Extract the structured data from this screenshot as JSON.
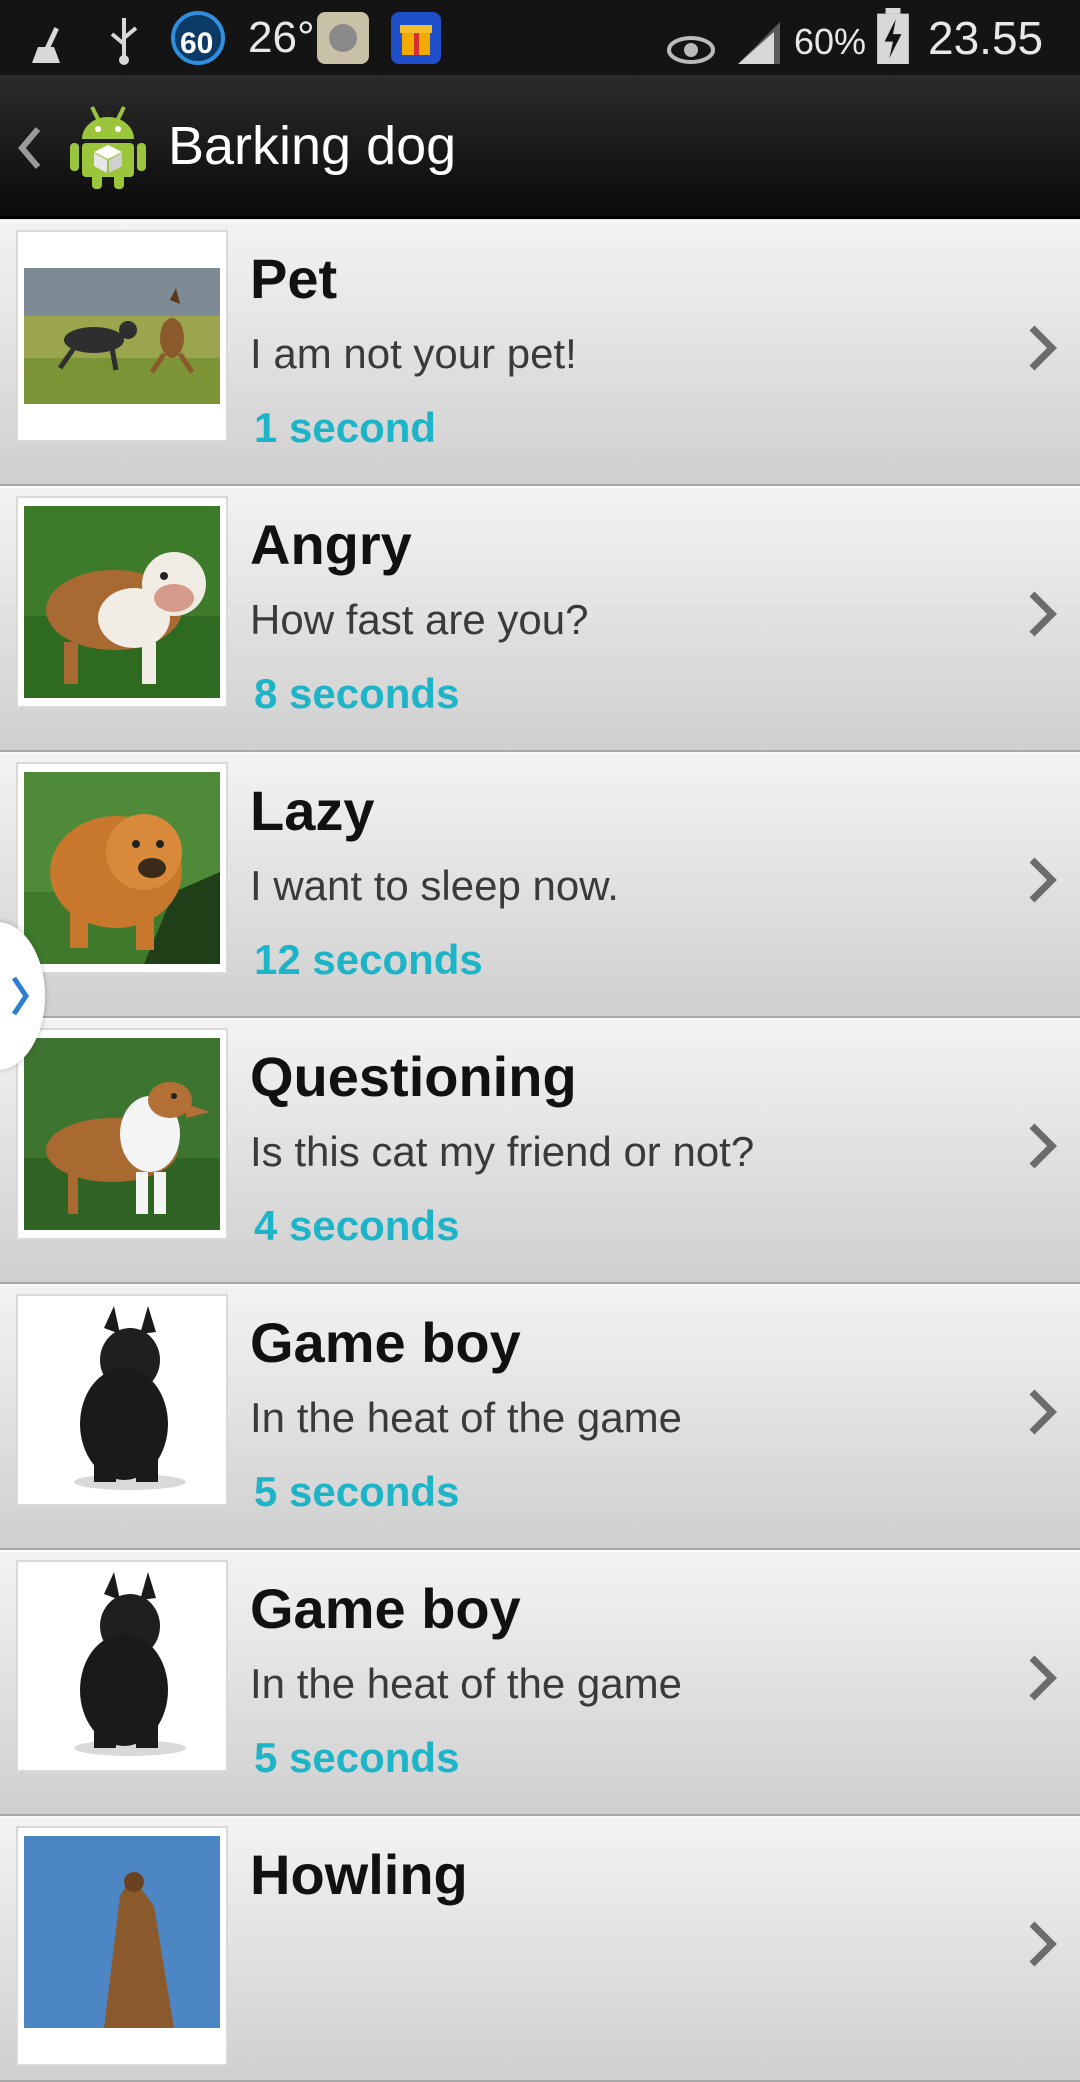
{
  "status_bar": {
    "icons": [
      "broom-icon",
      "usb-icon",
      "speed-60-icon",
      "app-icon",
      "gift-icon",
      "eye-icon",
      "signal-icon",
      "battery-charging-icon"
    ],
    "speed_label": "60",
    "temperature": "26°",
    "battery_percent": "60%",
    "time": "23.55"
  },
  "action_bar": {
    "title": "Barking dog"
  },
  "items": [
    {
      "title": "Pet",
      "subtitle": "I am not your pet!",
      "duration": "1 second"
    },
    {
      "title": "Angry",
      "subtitle": "How fast are you?",
      "duration": "8 seconds"
    },
    {
      "title": "Lazy",
      "subtitle": "I want to sleep now.",
      "duration": "12 seconds"
    },
    {
      "title": "Questioning",
      "subtitle": "Is this cat my friend or not?",
      "duration": "4 seconds"
    },
    {
      "title": "Game boy",
      "subtitle": "In the heat of the game",
      "duration": "5 seconds"
    },
    {
      "title": "Game boy",
      "subtitle": "In the heat of the game",
      "duration": "5 seconds"
    },
    {
      "title": "Howling",
      "subtitle": "",
      "duration": ""
    }
  ],
  "colors": {
    "accent": "#1db4c8",
    "status_bar": "#141414",
    "action_bar": "#0a0a0a",
    "row_top": "#f3f3f3",
    "row_bottom": "#cfcfcf"
  }
}
